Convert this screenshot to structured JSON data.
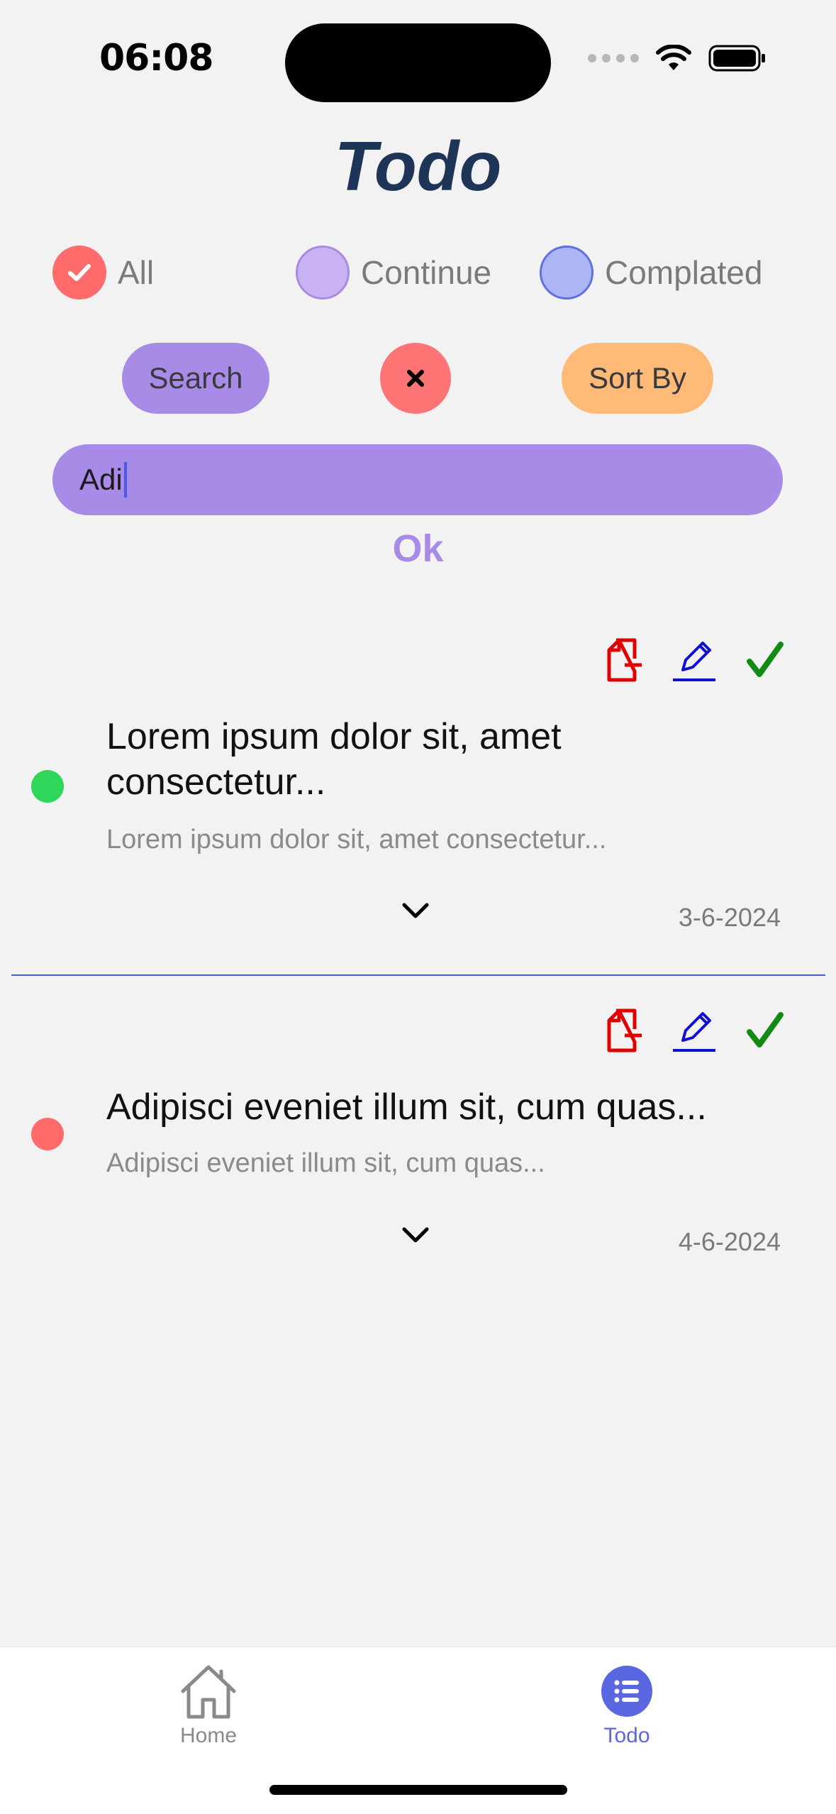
{
  "status_bar": {
    "time": "06:08"
  },
  "app": {
    "title": "Todo"
  },
  "filters": [
    {
      "label": "All",
      "selected": true,
      "color": "#ff6b6b"
    },
    {
      "label": "Continue",
      "selected": false,
      "color": "#c9b2f2"
    },
    {
      "label": "Complated",
      "selected": false,
      "color": "#aeb5f4"
    }
  ],
  "actions": {
    "search_label": "Search",
    "clear_icon": "close-icon",
    "sort_label": "Sort By"
  },
  "search": {
    "value": "Adi",
    "ok_label": "Ok"
  },
  "todos": [
    {
      "title": "Lorem ipsum dolor sit, amet consectetur...",
      "description": "Lorem ipsum dolor sit, amet consectetur...",
      "date": "3-6-2024",
      "status_color": "#2fd65a",
      "icons": [
        "delete-file-icon",
        "edit-icon",
        "check-icon"
      ]
    },
    {
      "title": "Adipisci eveniet illum sit, cum quas...",
      "description": "Adipisci eveniet illum sit, cum quas...",
      "date": "4-6-2024",
      "status_color": "#ff6b6b",
      "icons": [
        "delete-file-icon",
        "edit-icon",
        "check-icon"
      ]
    }
  ],
  "tabbar": {
    "tabs": [
      {
        "label": "Home",
        "icon": "home-icon",
        "active": false
      },
      {
        "label": "Todo",
        "icon": "list-icon",
        "active": true
      }
    ]
  },
  "colors": {
    "accent": "#a78be6",
    "title": "#1f3557",
    "active_tab": "#5a67e0",
    "delete": "#e00000",
    "edit": "#1010d0",
    "check": "#138a13"
  }
}
